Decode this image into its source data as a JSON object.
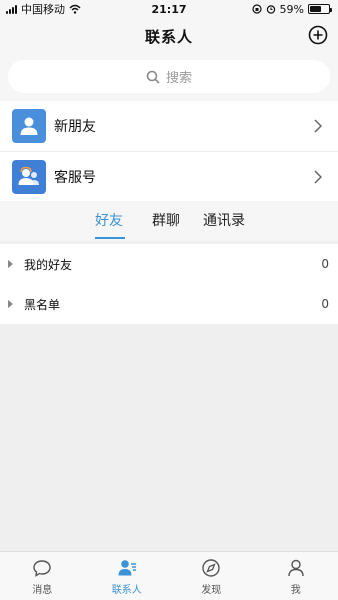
{
  "status_bar": {
    "carrier": "中国移动",
    "time": "21:17",
    "battery": "59%",
    "battery_level": 0.59
  },
  "header": {
    "title": "联系人",
    "add_icon": "plus-circle-icon"
  },
  "search": {
    "placeholder": "搜索"
  },
  "functions": [
    {
      "label": "新朋友",
      "icon": "new-friend-icon",
      "color": "#4a8fdc"
    },
    {
      "label": "客服号",
      "icon": "customer-service-icon",
      "color": "#3f7fd6"
    }
  ],
  "tabs": [
    {
      "label": "好友",
      "active": true
    },
    {
      "label": "群聊",
      "active": false
    },
    {
      "label": "通讯录",
      "active": false
    }
  ],
  "groups": [
    {
      "label": "我的好友",
      "count": "0"
    },
    {
      "label": "黑名单",
      "count": "0"
    }
  ],
  "bottom_nav": [
    {
      "label": "消息",
      "icon": "chat-bubble-icon",
      "active": false
    },
    {
      "label": "联系人",
      "icon": "contacts-icon",
      "active": true
    },
    {
      "label": "发现",
      "icon": "compass-icon",
      "active": false
    },
    {
      "label": "我",
      "icon": "person-icon",
      "active": false
    }
  ],
  "colors": {
    "accent": "#3a93d6",
    "icon_blue": "#4a8fdc"
  }
}
